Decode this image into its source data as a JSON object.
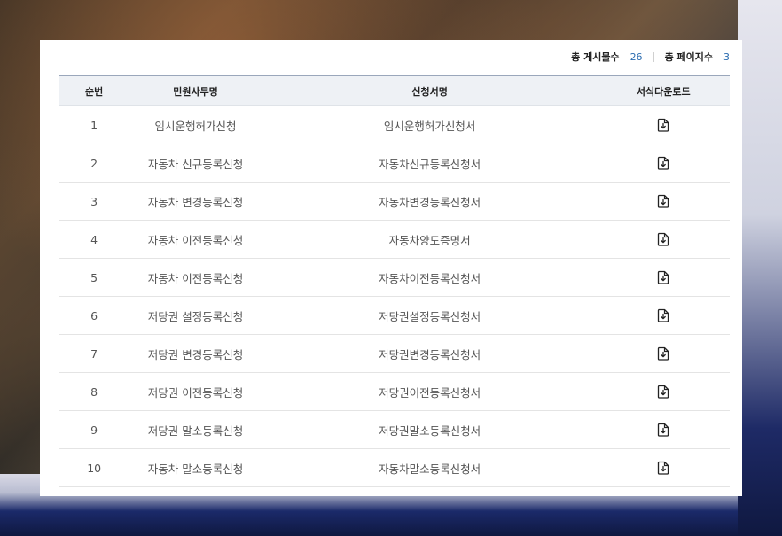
{
  "summary": {
    "total_posts_label": "총 게시물수",
    "total_posts_value": "26",
    "total_pages_label": "총 페이지수",
    "total_pages_value": "3"
  },
  "table": {
    "headers": [
      "순번",
      "민원사무명",
      "신청서명",
      "서식다운로드"
    ],
    "rows": [
      {
        "no": "1",
        "service": "임시운행허가신청",
        "form": "임시운행허가신청서",
        "icon": "download-file-icon"
      },
      {
        "no": "2",
        "service": "자동차 신규등록신청",
        "form": "자동차신규등록신청서",
        "icon": "download-file-icon"
      },
      {
        "no": "3",
        "service": "자동차 변경등록신청",
        "form": "자동차변경등록신청서",
        "icon": "download-file-icon"
      },
      {
        "no": "4",
        "service": "자동차 이전등록신청",
        "form": "자동차양도증명서",
        "icon": "download-file-icon"
      },
      {
        "no": "5",
        "service": "자동차 이전등록신청",
        "form": "자동차이전등록신청서",
        "icon": "download-file-icon"
      },
      {
        "no": "6",
        "service": "저당권 설정등록신청",
        "form": "저당권설정등록신청서",
        "icon": "download-file-icon"
      },
      {
        "no": "7",
        "service": "저당권 변경등록신청",
        "form": "저당권변경등록신청서",
        "icon": "download-file-icon"
      },
      {
        "no": "8",
        "service": "저당권 이전등록신청",
        "form": "저당권이전등록신청서",
        "icon": "download-file-icon"
      },
      {
        "no": "9",
        "service": "저당권 말소등록신청",
        "form": "저당권말소등록신청서",
        "icon": "download-file-icon"
      },
      {
        "no": "10",
        "service": "자동차 말소등록신청",
        "form": "자동차말소등록신청서",
        "icon": "download-file-icon"
      }
    ]
  }
}
